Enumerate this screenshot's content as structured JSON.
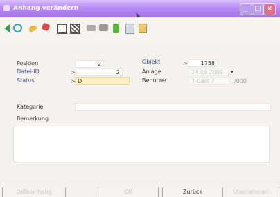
{
  "window": {
    "title": "Anhang verändern"
  },
  "toolbar": {
    "icons": [
      "back-arrow-icon",
      "refresh-icon",
      "key-icon",
      "tool-icon",
      "blank-icon",
      "grid-icon",
      "printer-icon",
      "printer-setup-icon",
      "bottle-icon",
      "document-icon",
      "clipboard-icon"
    ]
  },
  "form": {
    "position_label": "Position",
    "position_value": "2",
    "objekt_label": "Objekt",
    "objekt_prefix": ">",
    "objekt_value": "1758",
    "datei_label": "Datei-ID",
    "datei_prefix": ">",
    "datei_value": "2",
    "anlage_label": "Anlage",
    "anlage_value": "24.04.2009",
    "status_label": "Status",
    "status_prefix": ">",
    "status_value": "D",
    "benutzer_label": "Benutzer",
    "benutzer_value": "7 Gast 7",
    "benutzer_suffix": "/000",
    "kategorie_label": "Kategorie",
    "kategorie_value": "",
    "bemerkung_label": "Bemerkung",
    "bemerkung_value": ""
  },
  "footer": {
    "dateianhang": "Dateianhang",
    "ok": "OK",
    "zurueck": "Zurück",
    "uebernehmen": "Übernehmen"
  }
}
